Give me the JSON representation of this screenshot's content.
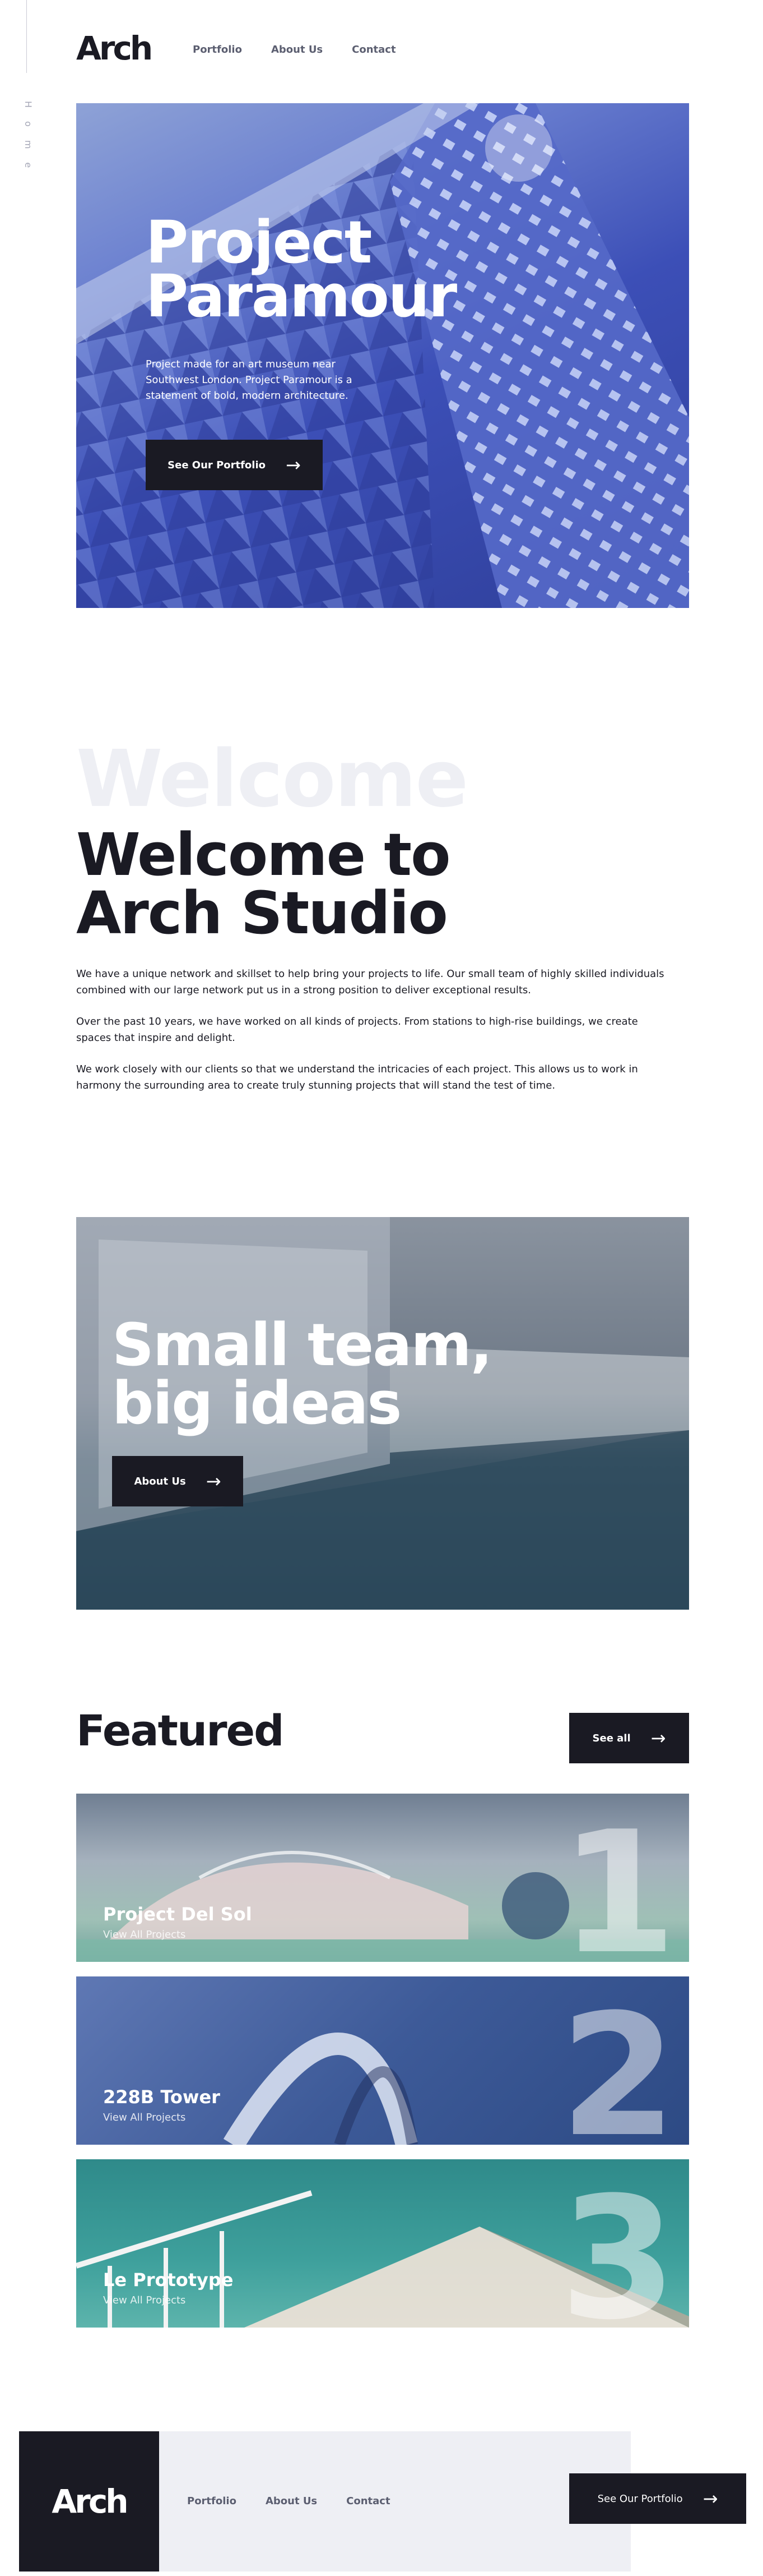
{
  "sidebar": {
    "label": "Home"
  },
  "header": {
    "logo": "Arch",
    "nav": [
      "Portfolio",
      "About Us",
      "Contact"
    ]
  },
  "hero": {
    "title": "Project Paramour",
    "description": "Project made for an art museum near Southwest London. Project Paramour is a statement of bold, modern architecture.",
    "button_label": "See Our Portfolio"
  },
  "welcome": {
    "ghost": "Welcome",
    "title": "Welcome to Arch Studio",
    "paragraphs": [
      "We have a unique network and skillset to help bring your projects to life. Our small team of highly skilled individuals combined with our large network put us in a strong position to deliver exceptional results.",
      "Over the past 10 years, we have worked on all kinds of projects. From stations to high-rise buildings, we create spaces that inspire and delight.",
      "We work closely with our clients so that we understand the intricacies of each project. This allows us to work in harmony the surrounding area to create truly stunning projects that will stand the test of time."
    ]
  },
  "team": {
    "title": "Small team, big ideas",
    "button_label": "About Us"
  },
  "featured": {
    "title": "Featured",
    "see_all_label": "See all",
    "items": [
      {
        "name": "Project Del Sol",
        "sub": "View All Projects",
        "number": "1"
      },
      {
        "name": "228B Tower",
        "sub": "View All Projects",
        "number": "2"
      },
      {
        "name": "Le Prototype",
        "sub": "View All Projects",
        "number": "3"
      }
    ]
  },
  "footer": {
    "logo": "Arch",
    "nav": [
      "Portfolio",
      "About Us",
      "Contact"
    ],
    "button_label": "See Our Portfolio"
  },
  "colors": {
    "primary": "#1a1a23",
    "nav_text": "#5b5e70",
    "light_bg": "#eeeff4",
    "rail": "#c9cad4"
  }
}
